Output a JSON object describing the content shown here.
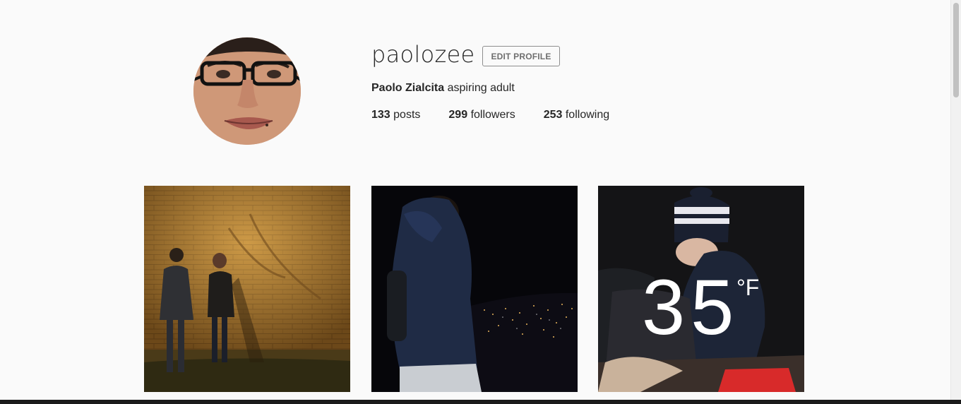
{
  "profile": {
    "username": "paolozee",
    "edit_button_label": "EDIT PROFILE",
    "full_name": "Paolo Zialcita",
    "bio": "aspiring adult",
    "stats": [
      {
        "num": "133",
        "label": "posts"
      },
      {
        "num": "299",
        "label": "followers"
      },
      {
        "num": "253",
        "label": "following"
      }
    ]
  },
  "posts": [
    {
      "description": "brick-wall-couple"
    },
    {
      "description": "hoodie-city-night"
    },
    {
      "description": "beanie-cold",
      "overlay_temp": "35",
      "overlay_unit": "°F"
    }
  ]
}
